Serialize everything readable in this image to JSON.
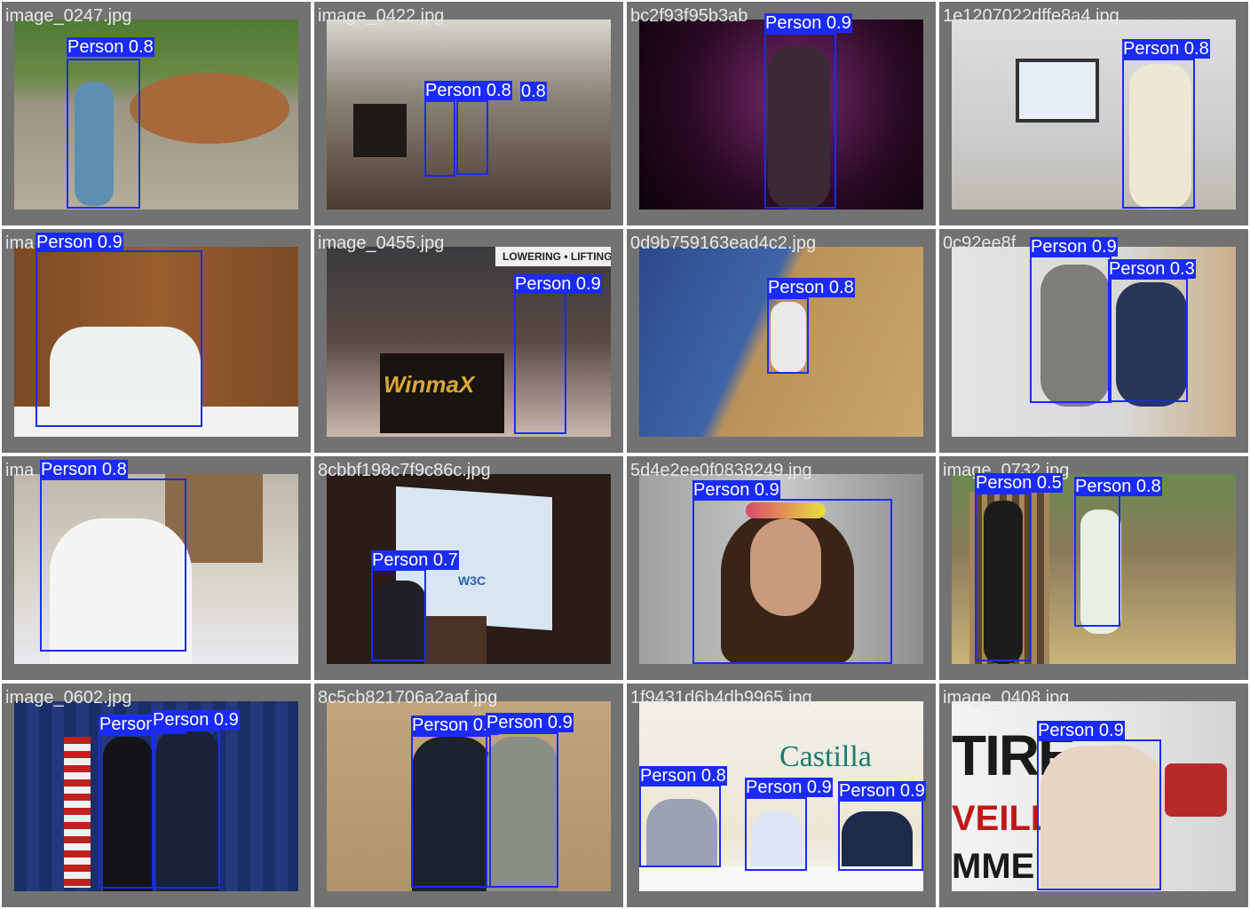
{
  "grid": {
    "tiles": [
      {
        "filename": "image_0247.jpg",
        "detections": [
          {
            "label": "Person 0.8"
          }
        ]
      },
      {
        "filename": "image_0422.jpg",
        "detections": [
          {
            "label": "Person 0.8"
          },
          {
            "label": "0.8"
          }
        ]
      },
      {
        "filename": "bc2f93f95b3ab",
        "detections": [
          {
            "label": "Person 0.9"
          }
        ]
      },
      {
        "filename": "1e1207022dffe8a4.jpg",
        "detections": [
          {
            "label": "Person 0.8"
          }
        ]
      },
      {
        "filename": "ima",
        "detections": [
          {
            "label": "Person 0.9"
          }
        ]
      },
      {
        "filename": "image_0455.jpg",
        "detections": [
          {
            "label": "Person 0.9"
          }
        ]
      },
      {
        "filename": "0d9b759163ead4c2.jpg",
        "detections": [
          {
            "label": "Person 0.8"
          }
        ]
      },
      {
        "filename": "0c92ee8f",
        "detections": [
          {
            "label": "Person 0.9"
          },
          {
            "label": "Person 0.3"
          }
        ]
      },
      {
        "filename": "ima",
        "detections": [
          {
            "label": "Person 0.8"
          }
        ]
      },
      {
        "filename": "8cbbf198c7f9c86c.jpg",
        "detections": [
          {
            "label": "Person 0.7"
          }
        ]
      },
      {
        "filename": "5d4e2ee0f0838249.jpg",
        "detections": [
          {
            "label": "Person 0.9"
          }
        ]
      },
      {
        "filename": "image_0732.jpg",
        "detections": [
          {
            "label": "Person 0.5"
          },
          {
            "label": "Person 0.8"
          }
        ]
      },
      {
        "filename": "image_0602.jpg",
        "detections": [
          {
            "label": "Person 0.9"
          },
          {
            "label": "Person 0.9"
          }
        ]
      },
      {
        "filename": "8c5cb821706a2aaf.jpg",
        "detections": [
          {
            "label": "Person 0.9"
          },
          {
            "label": "Person 0.9"
          }
        ]
      },
      {
        "filename": "1f9431d6b4db9965.jpg",
        "detections": [
          {
            "label": "Person 0.8"
          },
          {
            "label": "Person 0.9"
          },
          {
            "label": "Person 0.9"
          }
        ]
      },
      {
        "filename": "image_0408.jpg",
        "detections": [
          {
            "label": "Person 0.9"
          }
        ]
      }
    ]
  },
  "colors": {
    "box": "#1b2bff",
    "tile_bg": "#727272",
    "page_bg": "#ffffff"
  },
  "scene_text": {
    "winmax_sign": "WinmaX",
    "lowering_banner": "LOWERING • LIFTING",
    "castilla_sign": "Castilla",
    "w3c_logo": "W3C",
    "tire_sign": "TIRE",
    "veill_sign": "VEILL",
    "mme_sign": "MME"
  }
}
